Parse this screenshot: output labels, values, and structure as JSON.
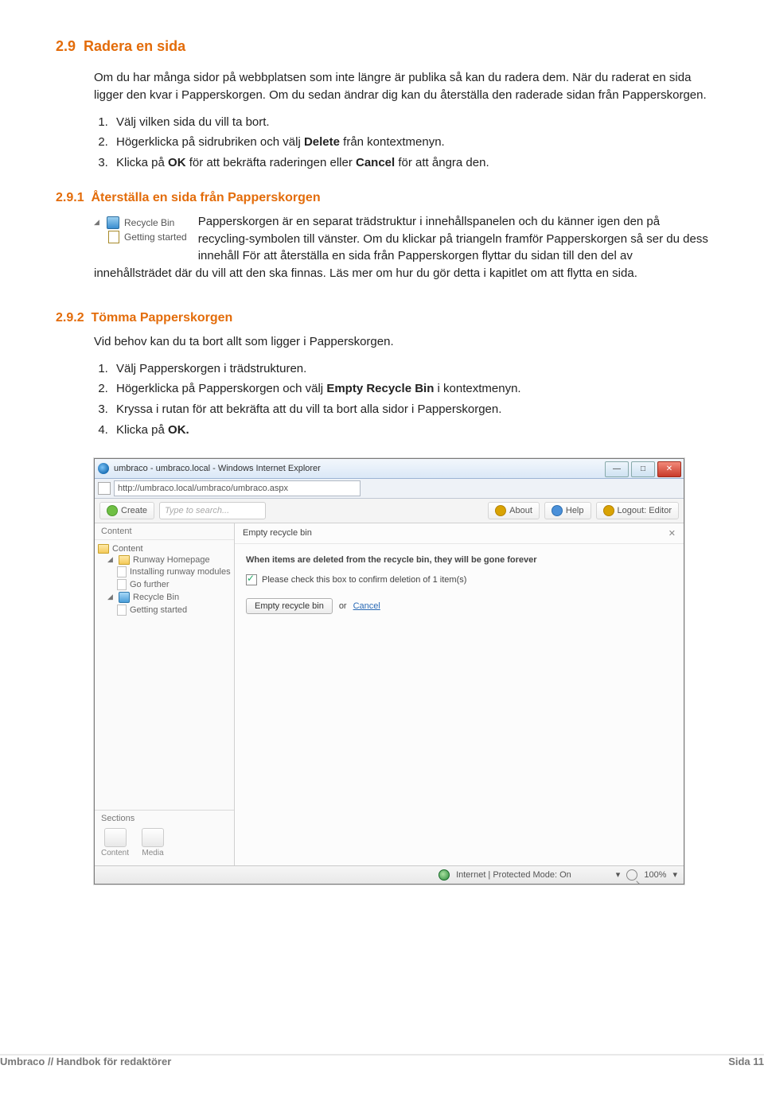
{
  "s29": {
    "number": "2.9",
    "title": "Radera en sida",
    "intro_run1": "Om du har många sidor på webbplatsen som inte längre är publika så kan du radera dem. När du raderat en sida ligger den kvar i Papperskorgen. Om du sedan ändrar dig kan du återställa den raderade sidan från Papperskorgen.",
    "steps": [
      "Välj vilken sida du vill ta bort.",
      {
        "pre": "Högerklicka på sidrubriken och välj ",
        "b": "Delete",
        "post": " från kontextmenyn."
      },
      {
        "pre": "Klicka på ",
        "b": "OK",
        "mid": " för att bekräfta raderingen eller ",
        "b2": "Cancel",
        "post": " för att ångra den."
      }
    ]
  },
  "s291": {
    "number": "2.9.1",
    "title": "Återställa en sida från Papperskorgen",
    "fig": {
      "row1": "Recycle Bin",
      "row2": "Getting started"
    },
    "body": "Papperskorgen är en separat trädstruktur i innehållspanelen och du känner igen den på recycling-symbolen till vänster. Om du klickar på triangeln framför Papperskorgen så ser du dess innehåll För att återställa en sida från Papperskorgen flyttar du sidan till den del av innehållsträdet där du vill att den ska finnas. Läs mer om hur du gör detta i kapitlet om att flytta en sida."
  },
  "s292": {
    "number": "2.9.2",
    "title": "Tömma Papperskorgen",
    "intro": "Vid behov kan du ta bort allt som ligger i Papperskorgen.",
    "steps": [
      "Välj Papperskorgen i trädstrukturen.",
      {
        "pre": "Högerklicka på Papperskorgen och välj ",
        "b": "Empty Recycle Bin",
        "post": " i kontextmenyn."
      },
      "Kryssa i rutan för att bekräfta att du vill ta bort alla sidor i Papperskorgen.",
      {
        "pre": "Klicka på ",
        "b": "OK.",
        "post": ""
      }
    ]
  },
  "screenshot": {
    "win_title": "umbraco - umbraco.local - Windows Internet Explorer",
    "url": "http://umbraco.local/umbraco/umbraco.aspx",
    "create": "Create",
    "search_ph": "Type to search...",
    "about": "About",
    "help": "Help",
    "logout": "Logout: Editor",
    "side_head": "Content",
    "tree": {
      "content": "Content",
      "runway": "Runway Homepage",
      "install": "Installing runway modules",
      "gofurther": "Go further",
      "recycle": "Recycle Bin",
      "getting": "Getting started"
    },
    "sections": "Sections",
    "sec_content": "Content",
    "sec_media": "Media",
    "panel_title": "Empty recycle bin",
    "warn": "When items are deleted from the recycle bin, they will be gone forever",
    "check": "Please check this box to confirm deletion of 1 item(s)",
    "empty_btn": "Empty recycle bin",
    "or": "or",
    "cancel": "Cancel",
    "status": "Internet | Protected Mode: On",
    "zoom": "100%"
  },
  "footer": {
    "left": "Umbraco // Handbok för redaktörer",
    "right": "Sida 11"
  }
}
